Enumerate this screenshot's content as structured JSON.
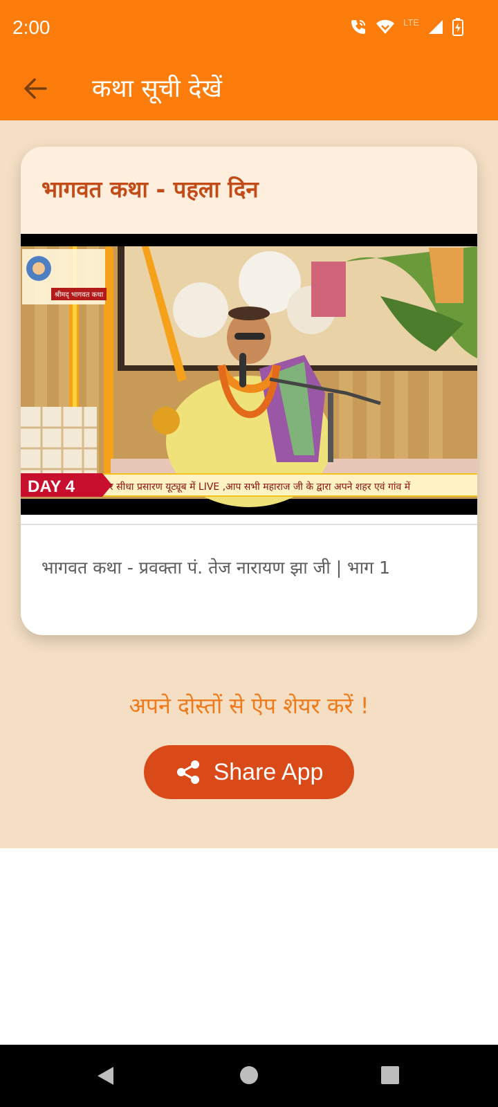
{
  "status_bar": {
    "time": "2:00",
    "network_label": "LTE",
    "icons": [
      "wifi-call-icon",
      "wifi-icon",
      "signal-icon",
      "battery-charging-icon"
    ]
  },
  "app_bar": {
    "title": "कथा सूची देखें",
    "back_icon": "arrow-back-icon"
  },
  "card": {
    "title": "भागवत कथा - पहला दिन",
    "description": "भागवत कथा - प्रवक्ता पं. तेज नारायण झा जी | भाग 1",
    "video": {
      "logo_text": "श्रीमद् भागवत कथा",
      "day_badge": "DAY 4",
      "ticker": "र सीधा प्रसारण यूट्यूब में LIVE ,आप सभी महाराज जी के द्वारा अपने शहर एवं गांव में"
    }
  },
  "share": {
    "prompt": "अपने दोस्तों से ऐप शेयर करें !",
    "button_label": "Share App",
    "button_icon": "share-icon"
  },
  "colors": {
    "app_bar": "#fc7d0b",
    "background": "#f4dfc4",
    "card_title": "#c24b18",
    "share_button": "#d94a18",
    "share_text": "#ee7a1c"
  },
  "nav": {
    "icons": [
      "back-triangle-icon",
      "home-circle-icon",
      "recents-square-icon"
    ]
  }
}
